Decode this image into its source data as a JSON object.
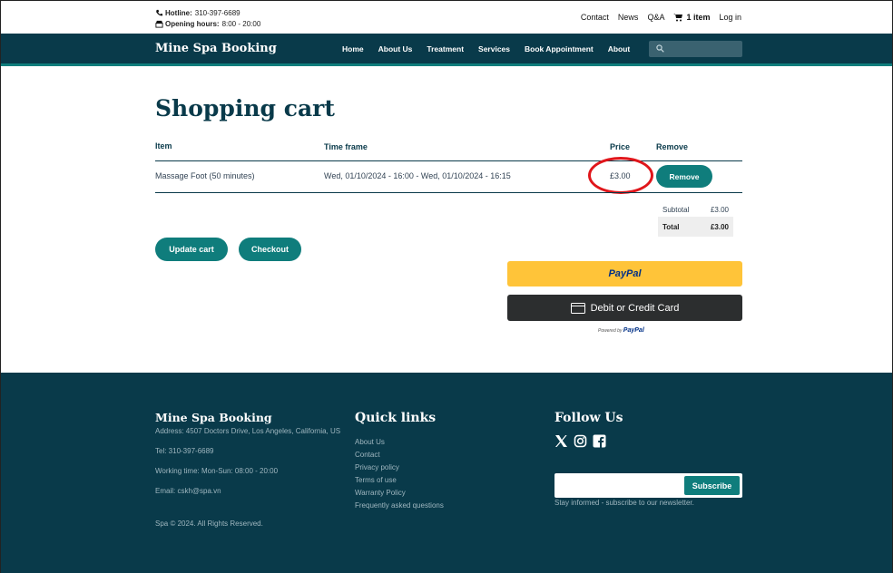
{
  "topbar": {
    "hotline_label": "Hotline:",
    "hotline_value": "310-397-6689",
    "hours_label": "Opening hours:",
    "hours_value": "8:00 - 20:00",
    "links": [
      "Contact",
      "News",
      "Q&A"
    ],
    "cart_label": "1 item",
    "login_label": "Log in"
  },
  "nav": {
    "brand": "Mine Spa Booking",
    "items": [
      "Home",
      "About Us",
      "Treatment",
      "Services",
      "Book Appointment",
      "About"
    ],
    "search_placeholder": ""
  },
  "cart": {
    "title": "Shopping cart",
    "headers": {
      "item": "Item",
      "time": "Time frame",
      "price": "Price",
      "remove": "Remove"
    },
    "rows": [
      {
        "item": "Massage Foot (50 minutes)",
        "time": "Wed, 01/10/2024 - 16:00 - Wed, 01/10/2024 - 16:15",
        "price": "£3.00",
        "remove_label": "Remove"
      }
    ],
    "subtotal_label": "Subtotal",
    "subtotal_value": "£3.00",
    "total_label": "Total",
    "total_value": "£3.00",
    "update_label": "Update cart",
    "checkout_label": "Checkout",
    "paypal_label": "PayPal",
    "card_label": "Debit or Credit Card",
    "powered_label": "Powered by",
    "powered_brand": "PayPal"
  },
  "footer": {
    "brand": "Mine Spa Booking",
    "address": "Address: 4507 Doctors Drive, Los Angeles, California, US",
    "tel": "Tel: 310-397-6689",
    "working": "Working time: Mon-Sun: 08:00 - 20:00",
    "email": "Email: cskh@spa.vn",
    "copyright": "Spa © 2024. All Rights Reserved.",
    "quicklinks_title": "Quick links",
    "quicklinks": [
      "About Us",
      "Contact",
      "Privacy policy",
      "Terms of use",
      "Warranty Policy",
      "Frequently asked questions"
    ],
    "follow_title": "Follow Us",
    "subscribe_label": "Subscribe",
    "subscribe_note": "Stay informed - subscribe to our newsletter."
  },
  "colors": {
    "primary": "#093a4a",
    "accent": "#0f7d7c",
    "highlight": "#e0161b",
    "paypal": "#ffc439"
  }
}
